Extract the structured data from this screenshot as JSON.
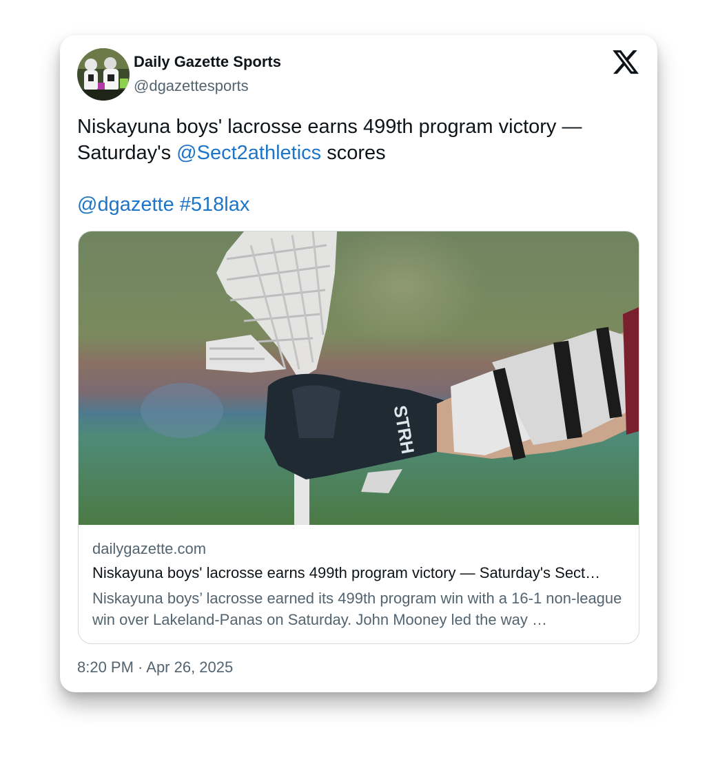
{
  "author": {
    "display_name": "Daily Gazette Sports",
    "handle": "@dgazettesports"
  },
  "platform_icon": "x-logo-icon",
  "tweet": {
    "text_part1": "Niskayuna boys' lacrosse earns 499th program victory — Saturday's ",
    "mention": "@Sect2athletics",
    "text_part2": " scores",
    "tag_mention": "@dgazette",
    "hashtag": "#518lax"
  },
  "link_card": {
    "domain": "dailygazette.com",
    "title": "Niskayuna boys' lacrosse earns 499th program victory — Saturday's Sect…",
    "description": "Niskayuna boys’ lacrosse earned its 499th program win with a 16-1 non-league win over Lakeland-Panas on Saturday. John Mooney led the way …"
  },
  "timestamp": "8:20 PM · Apr 26, 2025",
  "colors": {
    "link": "#1d75c9",
    "text": "#0f1419",
    "secondary": "#536471"
  }
}
